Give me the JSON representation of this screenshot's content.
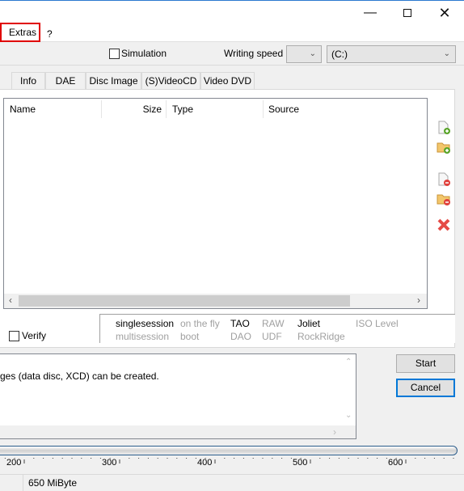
{
  "menu": {
    "items": [
      "Extras",
      "?"
    ]
  },
  "toolbar": {
    "simulation_label": "Simulation",
    "simulation_checked": false,
    "writing_speed_label": "Writing speed",
    "writing_speed_value": "",
    "drive_value": "(C:)"
  },
  "tabs": [
    "Info",
    "DAE",
    "Disc Image",
    "(S)VideoCD",
    "Video DVD"
  ],
  "file_list": {
    "columns": [
      "Name",
      "Size",
      "Type",
      "Source"
    ],
    "rows": []
  },
  "side_icons": [
    "add-file-icon",
    "add-folder-icon",
    "remove-file-icon",
    "remove-folder-icon",
    "clear-list-icon"
  ],
  "verify": {
    "label": "Verify",
    "checked": false
  },
  "options": {
    "row1": [
      {
        "t": "singlesession",
        "on": true
      },
      {
        "t": "on the fly",
        "on": false
      },
      {
        "t": "TAO",
        "on": true
      },
      {
        "t": "RAW",
        "on": false
      },
      {
        "t": "Joliet",
        "on": true
      },
      {
        "t": "ISO Level",
        "on": false
      }
    ],
    "row2": [
      {
        "t": "multisession",
        "on": false
      },
      {
        "t": "boot",
        "on": false
      },
      {
        "t": "DAO",
        "on": false
      },
      {
        "t": "UDF",
        "on": false
      },
      {
        "t": "RockRidge",
        "on": false
      }
    ]
  },
  "log": {
    "text": "ges (data disc, XCD) can be created."
  },
  "buttons": {
    "start": "Start",
    "cancel": "Cancel"
  },
  "ruler": {
    "labels": [
      "200",
      "300",
      "400",
      "500",
      "600"
    ]
  },
  "status": {
    "capacity": "650 MiByte"
  },
  "colors": {
    "accent": "#0078d7",
    "highlight": "#e00000"
  }
}
